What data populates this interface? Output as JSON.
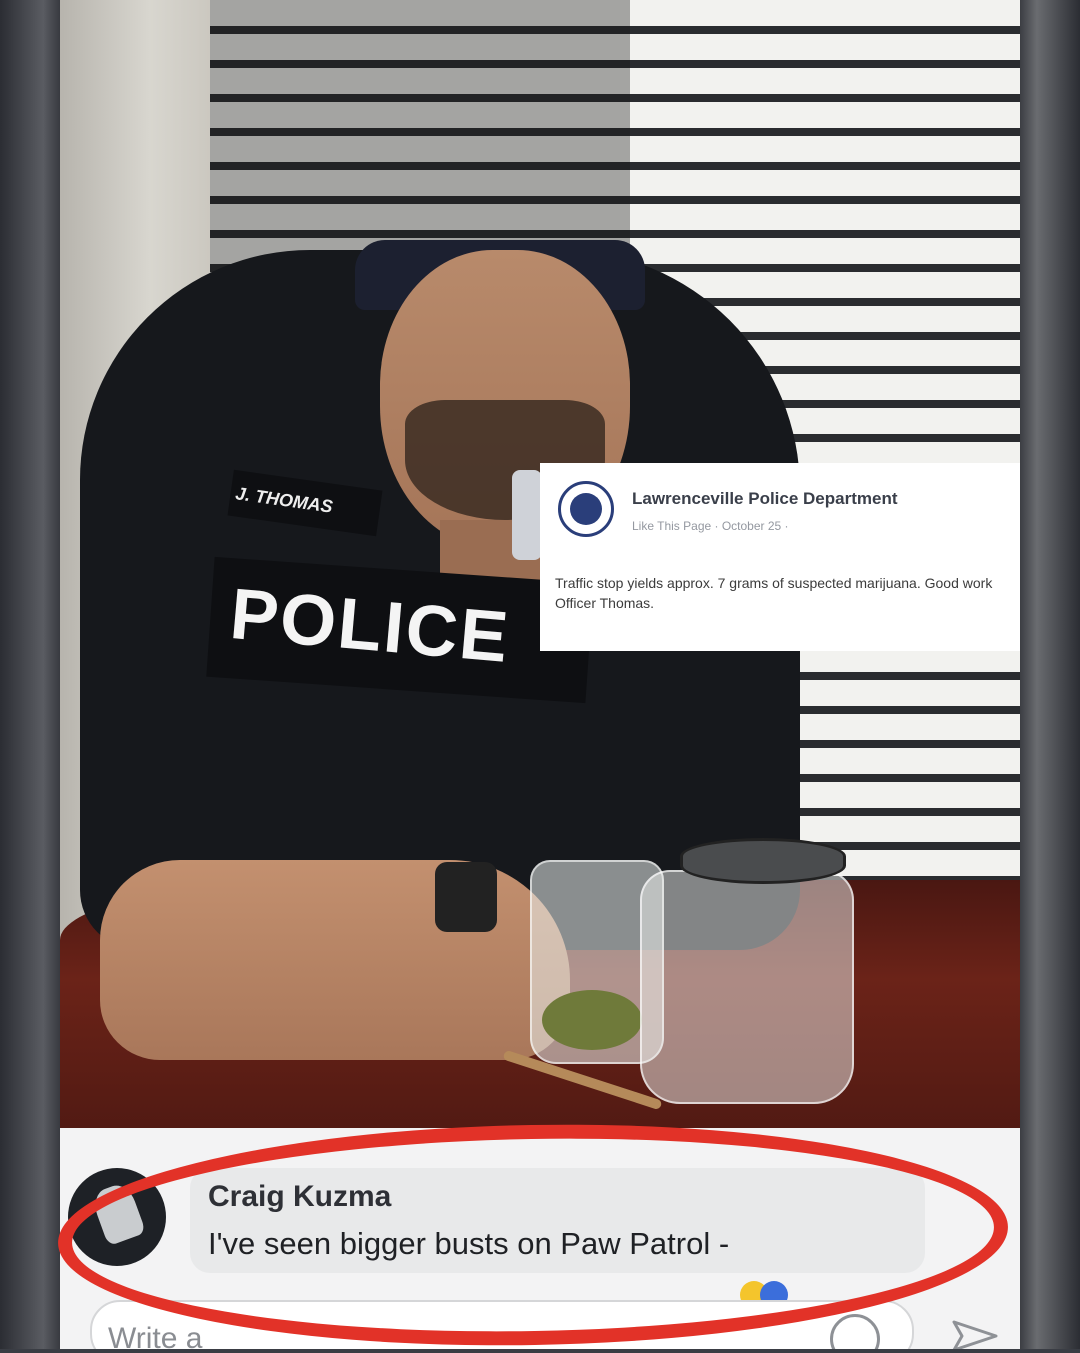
{
  "post": {
    "page_name": "Lawrenceville Police Department",
    "meta": "Like This Page · October 25 ·",
    "text": "Traffic stop yields approx. 7 grams of suspected marijuana. Good work Officer Thomas."
  },
  "photo": {
    "police_label": "POLICE",
    "nametag": "J. THOMAS"
  },
  "comment": {
    "author": "Craig Kuzma",
    "text": "I've seen bigger busts on Paw Patrol -"
  },
  "composer": {
    "placeholder": "Write a"
  },
  "colors": {
    "highlight": "#e23228",
    "fb_blue": "#3b5998"
  }
}
